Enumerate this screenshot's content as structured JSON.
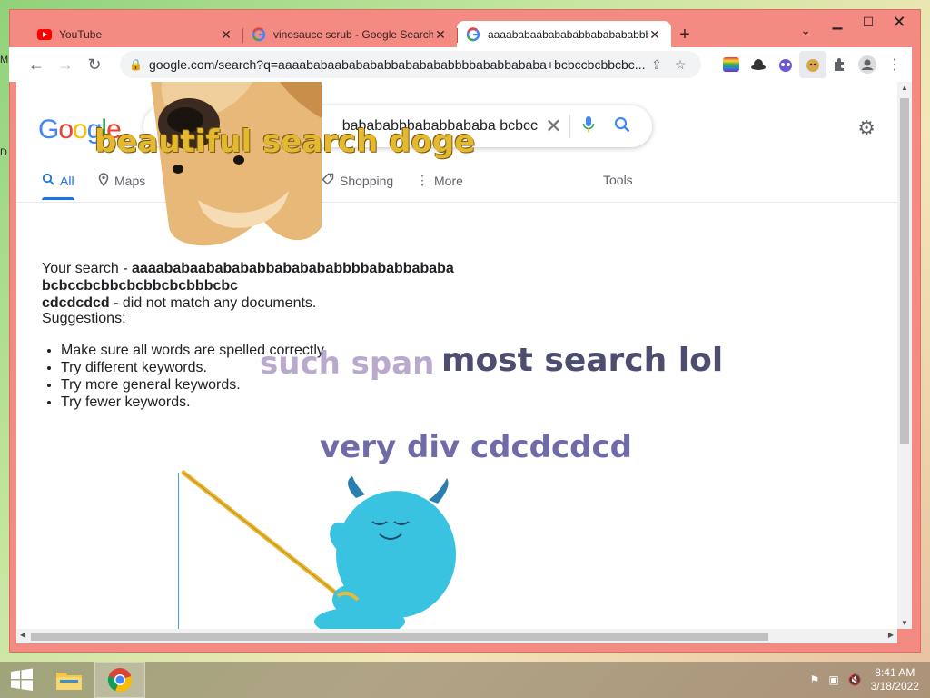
{
  "desktop": {
    "icon_m": "M",
    "icon_d": "D"
  },
  "window": {
    "minimize": "▁",
    "maximize": "☐",
    "close": "✕",
    "tab_search": "⌄"
  },
  "tabs": [
    {
      "title": "YouTube",
      "icon": "youtube-icon",
      "close": "✕"
    },
    {
      "title": "vinesauce scrub - Google Search",
      "icon": "google-icon",
      "close": "✕"
    },
    {
      "title": "aaaababaababababbababababbb",
      "icon": "google-icon",
      "close": "✕",
      "active": true
    }
  ],
  "new_tab": "+",
  "toolbar": {
    "back": "←",
    "forward": "→",
    "reload": "↻",
    "url": "google.com/search?q=aaaababaababababbababababbbbababbababa+bcbccbcbbcbc..."
  },
  "search": {
    "query": "babababbbababbababa bcbcc",
    "tabs": [
      {
        "label": "All",
        "icon": "search-icon",
        "active": true
      },
      {
        "label": "Maps",
        "icon": "map-pin-icon"
      },
      {
        "label": "Shopping",
        "icon": "tag-icon"
      },
      {
        "label": "More",
        "icon": "more-icon"
      },
      {
        "label": "Tools"
      }
    ]
  },
  "result": {
    "prefix": "Your search - ",
    "query_line1": "aaaababaababababbababababbbbababbababa bcbccbcbbcbcbbcbcbbbcbc",
    "query_line2": "cdcdcdcd",
    "suffix": " - did not match any documents.",
    "suggestions_title": "Suggestions:",
    "suggestions": [
      "Make sure all words are spelled correctly.",
      "Try different keywords.",
      "Try more general keywords.",
      "Try fewer keywords."
    ]
  },
  "doge": {
    "beautiful": "beautiful search doge",
    "such": "such span",
    "most": "most search lol",
    "very": "very div cdcdcdcd"
  },
  "taskbar": {
    "time": "8:41 AM",
    "date": "3/18/2022"
  }
}
